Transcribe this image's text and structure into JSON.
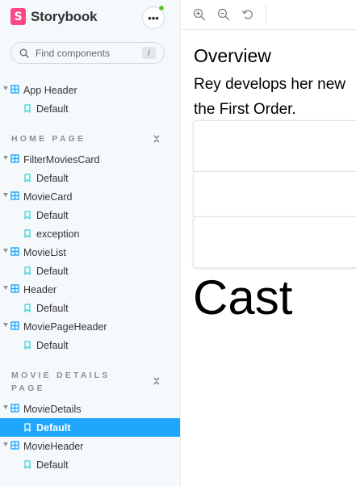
{
  "brand": {
    "logo_letter": "S",
    "name": "Storybook"
  },
  "menu": {
    "label": "•••"
  },
  "search": {
    "placeholder": "Find components",
    "shortcut": "/"
  },
  "sidebar": {
    "sections": [
      {
        "title": "HOME PAGE"
      },
      {
        "title_line1": "MOVIE DETAILS",
        "title_line2": "PAGE"
      }
    ],
    "items": [
      {
        "label": "App Header"
      },
      {
        "label": "Default"
      },
      {
        "label": "FilterMoviesCard"
      },
      {
        "label": "Default"
      },
      {
        "label": "MovieCard"
      },
      {
        "label": "Default"
      },
      {
        "label": "exception"
      },
      {
        "label": "MovieList"
      },
      {
        "label": "Default"
      },
      {
        "label": "Header"
      },
      {
        "label": "Default"
      },
      {
        "label": "MoviePageHeader"
      },
      {
        "label": "Default"
      },
      {
        "label": "MovieDetails"
      },
      {
        "label": "Default"
      },
      {
        "label": "MovieHeader"
      },
      {
        "label": "Default"
      }
    ]
  },
  "preview": {
    "title": "Overview",
    "line1": "Rey develops her new",
    "line2": "the First Order.",
    "heading": "Cast"
  },
  "colors": {
    "accent": "#1ea7fd",
    "brand": "#ff4785",
    "status_dot": "#66bf3c",
    "component_icon": "#1ea7fd",
    "story_icon": "#37d5d3"
  }
}
